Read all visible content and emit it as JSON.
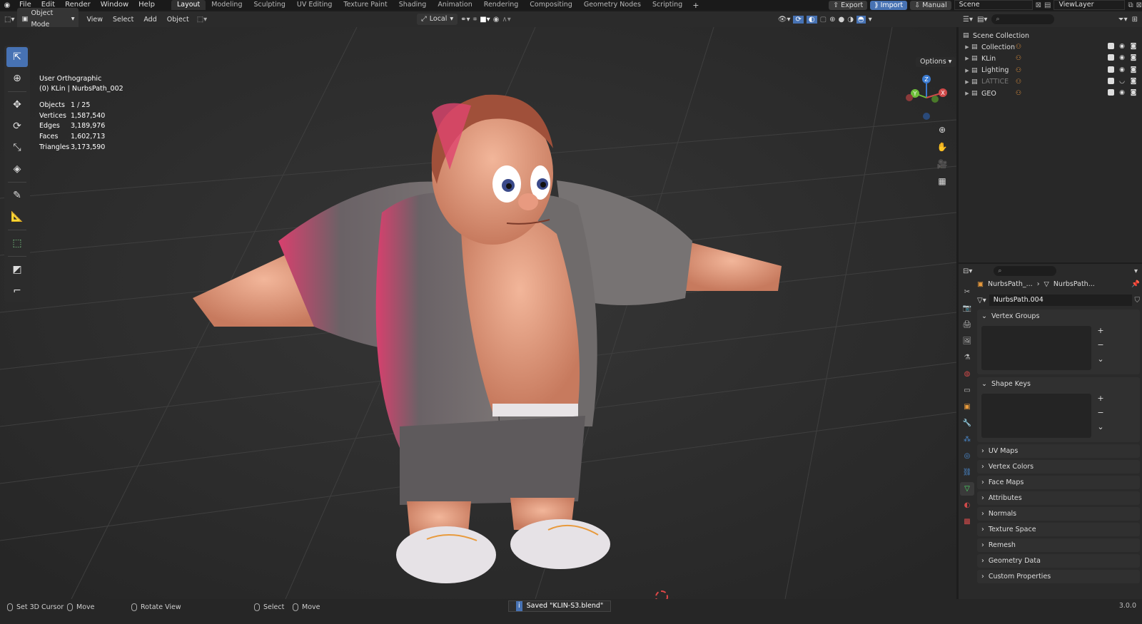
{
  "topbar": {
    "menu": [
      "File",
      "Edit",
      "Render",
      "Window",
      "Help"
    ],
    "workspaces": [
      "Layout",
      "Modeling",
      "Sculpting",
      "UV Editing",
      "Texture Paint",
      "Shading",
      "Animation",
      "Rendering",
      "Compositing",
      "Geometry Nodes",
      "Scripting"
    ],
    "active_workspace": "Layout",
    "add_tab_glyph": "+",
    "export_label": "Export",
    "import_label": "Import",
    "manual_label": "Manual",
    "scene_value": "Scene",
    "viewlayer_value": "ViewLayer"
  },
  "header3d": {
    "mode": "Object Mode",
    "menus": [
      "View",
      "Select",
      "Add",
      "Object"
    ],
    "transform_orientation": "Local",
    "options_label": "Options"
  },
  "viewport": {
    "view_name": "User Orthographic",
    "active_object": "(0) KLin | NurbsPath_002",
    "stats": [
      {
        "k": "Objects",
        "v": "1 / 25"
      },
      {
        "k": "Vertices",
        "v": "1,587,540"
      },
      {
        "k": "Edges",
        "v": "3,189,976"
      },
      {
        "k": "Faces",
        "v": "1,602,713"
      },
      {
        "k": "Triangles",
        "v": "3,173,590"
      }
    ],
    "gizmo_axes": [
      "Z",
      "X",
      "Y"
    ]
  },
  "outliner": {
    "root": "Scene Collection",
    "rows": [
      {
        "label": "Collection",
        "dim": false
      },
      {
        "label": "KLin",
        "dim": false
      },
      {
        "label": "Lighting",
        "dim": false
      },
      {
        "label": "LATTICE",
        "dim": true
      },
      {
        "label": "GEO",
        "dim": false
      }
    ]
  },
  "properties": {
    "breadcrumb_left": "NurbsPath_...",
    "breadcrumb_right": "NurbsPath...",
    "data_name": "NurbsPath.004",
    "vertex_groups": "Vertex Groups",
    "shape_keys": "Shape Keys",
    "collapsed_panels": [
      "UV Maps",
      "Vertex Colors",
      "Face Maps",
      "Attributes",
      "Normals",
      "Texture Space",
      "Remesh",
      "Geometry Data",
      "Custom Properties"
    ],
    "active_tab_color": "#4ee06a"
  },
  "statusbar": {
    "set_cursor": "Set 3D Cursor",
    "move1": "Move",
    "rotate": "Rotate View",
    "select": "Select",
    "move2": "Move",
    "saved_message": "Saved \"KLIN-S3.blend\"",
    "version": "3.0.0"
  },
  "colors": {
    "accent": "#4772b3",
    "background": "#2f2f2f",
    "outline_selected": "#e89a3c"
  }
}
